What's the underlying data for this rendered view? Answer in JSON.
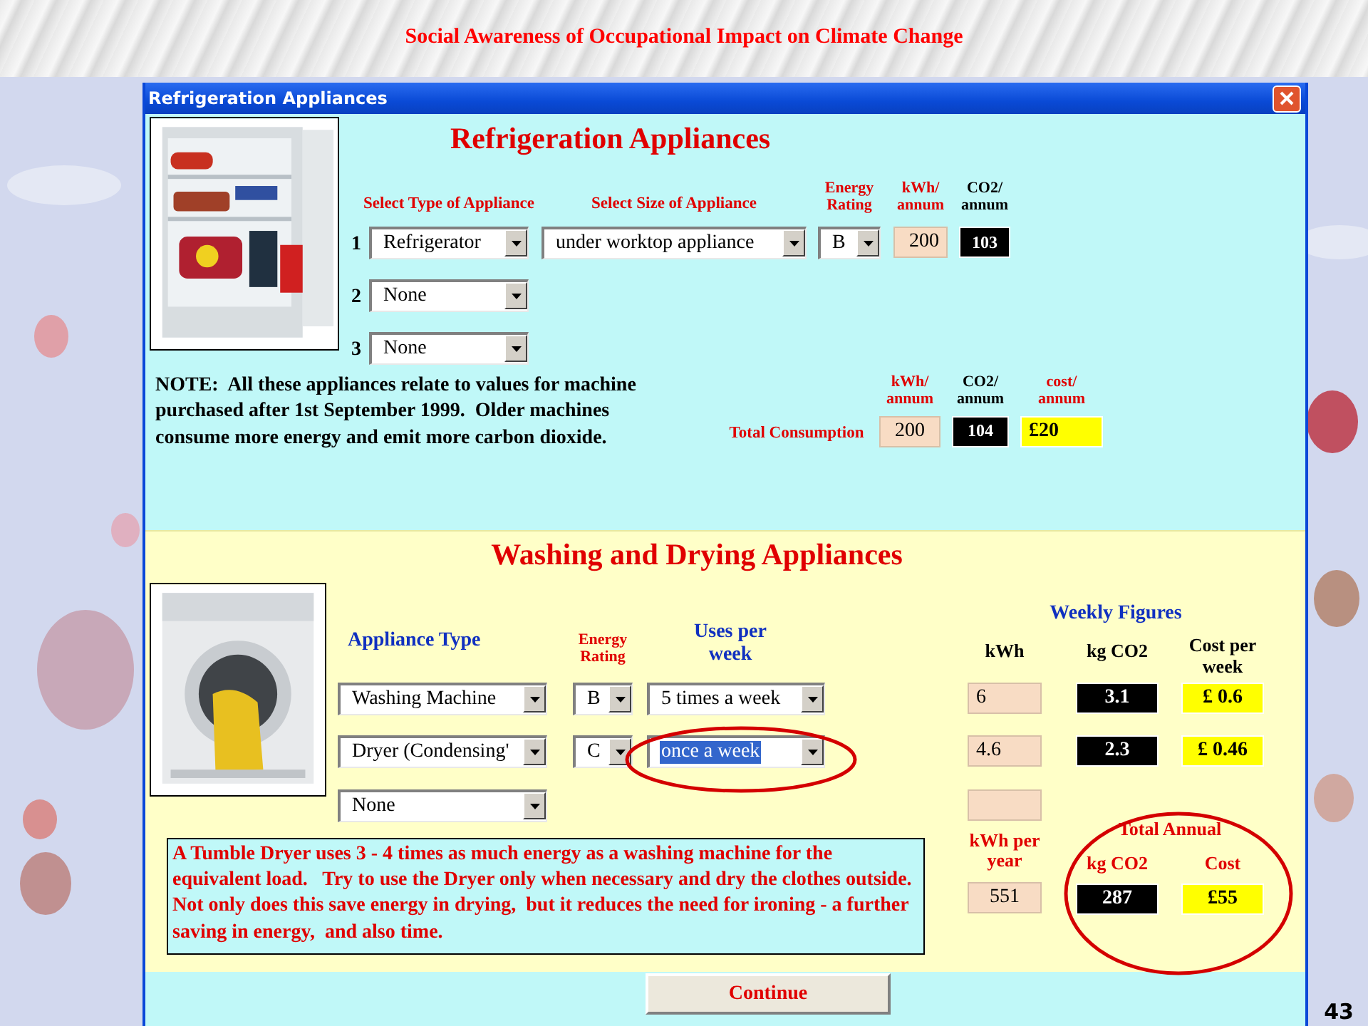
{
  "slide": {
    "title": "Social Awareness of Occupational Impact on Climate Change",
    "number": "43"
  },
  "window": {
    "title": "Refrigeration Appliances"
  },
  "refrigeration": {
    "heading": "Refrigeration Appliances",
    "columns": [
      {
        "label": "Select Type of Appliance",
        "color": "#e00000"
      },
      {
        "label": "Select Size of Appliance",
        "color": "#e00000"
      },
      {
        "label": "Energy\nRating",
        "color": "#e00000"
      },
      {
        "label": "kWh/\nannum",
        "color": "#e00000"
      },
      {
        "label": "CO2/\nannum",
        "color": "#000000"
      }
    ],
    "rows": [
      {
        "number": "1",
        "type": "Refrigerator",
        "size": "under worktop appliance",
        "rating": "B",
        "kwh": "200",
        "co2": "103"
      },
      {
        "number": "2",
        "type": "None"
      },
      {
        "number": "3",
        "type": "None"
      }
    ],
    "note": "NOTE:  All these appliances relate to values for machine purchased after 1st September 1999.  Older machines consume more energy and emit more carbon dioxide.",
    "total": {
      "label": "Total Consumption",
      "columns": [
        "kWh/\nannum",
        "CO2/\nannum",
        "cost/\nannum"
      ],
      "kwh": "200",
      "co2": "104",
      "cost": "£20"
    }
  },
  "washing": {
    "heading": "Washing and Drying Appliances",
    "columns": {
      "type": "Appliance Type",
      "rating": "Energy\nRating",
      "uses": "Uses per\nweek"
    },
    "weekly": {
      "title": "Weekly Figures",
      "kwh": "kWh",
      "co2": "kg CO2",
      "cost": "Cost per\nweek"
    },
    "rows": [
      {
        "type": "Washing Machine",
        "rating": "B",
        "uses": "5 times a week",
        "uses_selected": false,
        "kwh": "6",
        "co2": "3.1",
        "cost": "£ 0.6"
      },
      {
        "type": "Dryer (Condensing'",
        "rating": "C",
        "uses": "once a week",
        "uses_selected": true,
        "kwh": "4.6",
        "co2": "2.3",
        "cost": "£ 0.46"
      },
      {
        "type": "None"
      }
    ],
    "info": "A Tumble Dryer uses 3 - 4 times as much energy as a washing machine for the equivalent load.   Try to use the Dryer only when necessary and dry the clothes outside.   Not only does this save energy in drying,  but it reduces the need for ironing - a further saving in energy,  and also time.",
    "annual": {
      "kwh_label": "kWh per\nyear",
      "kwh": "551",
      "title": "Total Annual",
      "co2_label": "kg CO2",
      "cost_label": "Cost",
      "co2": "287",
      "cost": "£55"
    }
  },
  "continue": "Continue"
}
